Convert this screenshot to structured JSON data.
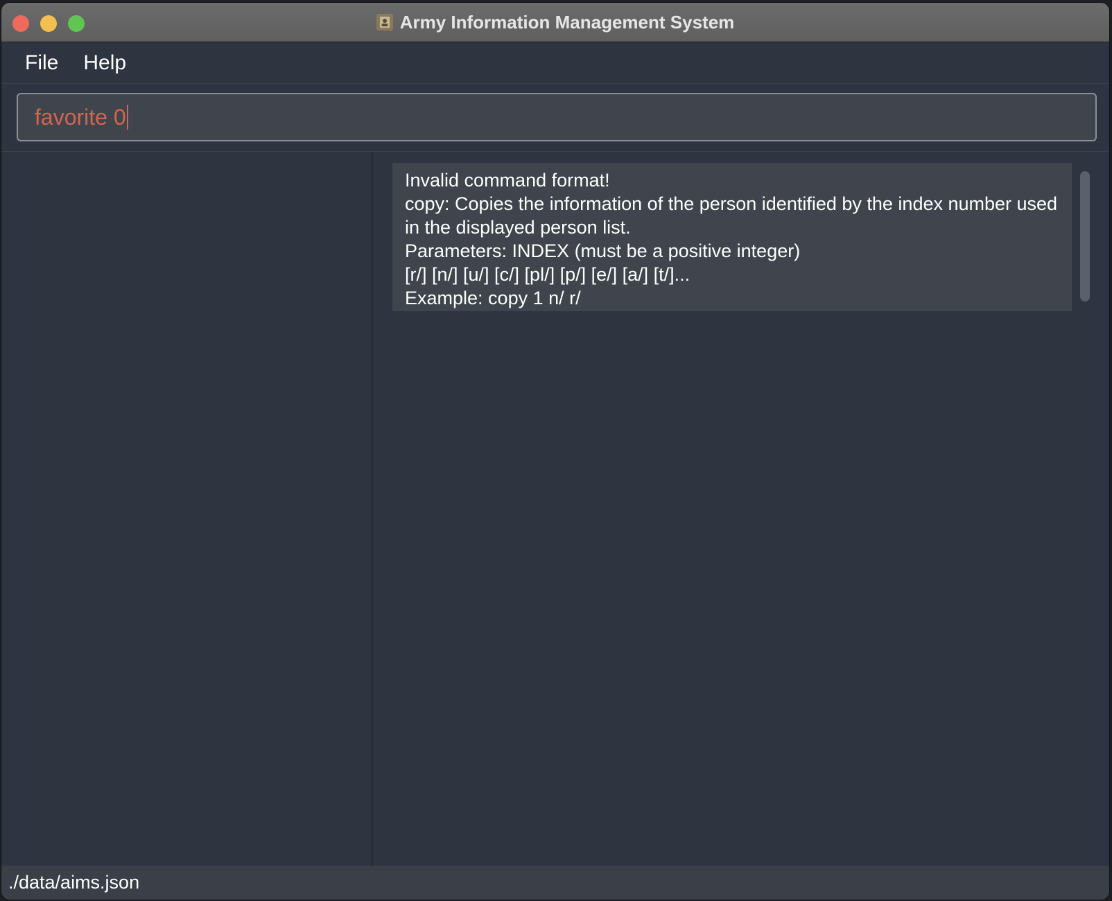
{
  "window": {
    "title": "Army Information Management System",
    "app_icon": "contact-book-icon"
  },
  "menu": {
    "items": [
      {
        "label": "File"
      },
      {
        "label": "Help"
      }
    ]
  },
  "command": {
    "value": "favorite 0",
    "text_color": "#d4664d"
  },
  "result": {
    "lines": [
      "Invalid command format!",
      "copy: Copies the information of the person identified by the index number used in the displayed person list.",
      "Parameters: INDEX (must be a positive integer)",
      "[r/] [n/] [u/] [c/] [pl/] [p/] [e/] [a/] [t/]...",
      "Example: copy 1 n/ r/"
    ]
  },
  "status": {
    "file_path": "./data/aims.json"
  },
  "colors": {
    "background": "#2e3440",
    "panel": "#3f444d",
    "error_text": "#d4664d"
  }
}
